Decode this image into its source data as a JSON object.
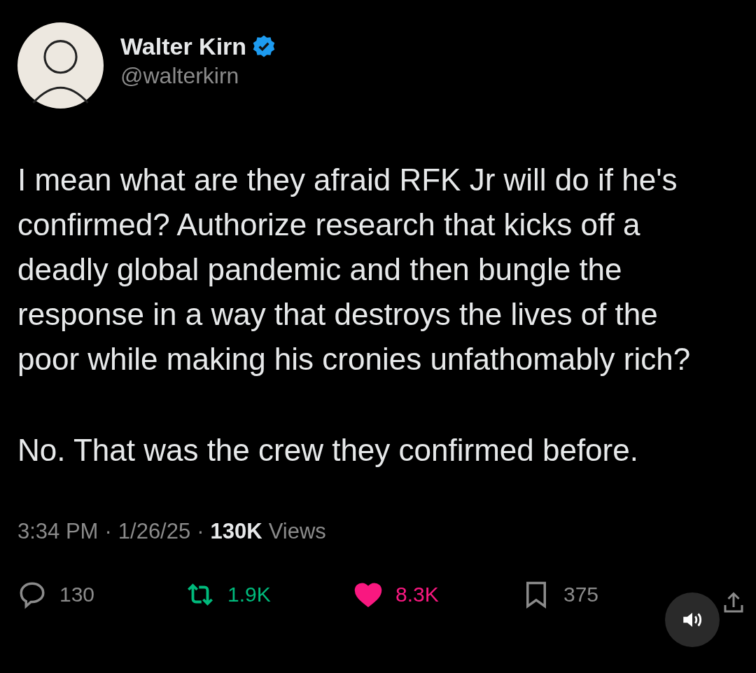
{
  "author": {
    "name": "Walter Kirn",
    "handle": "@walterkirn",
    "verified": true
  },
  "paragraphs": [
    "I mean what are they afraid RFK Jr will do if he's confirmed? Authorize research that kicks off a deadly global pandemic and then bungle the response in a way that destroys the lives of the poor while making his cronies unfathomably rich?",
    "No. That was the crew they confirmed before."
  ],
  "meta": {
    "time": "3:34 PM",
    "separator": "·",
    "date": "1/26/25",
    "views_count": "130K",
    "views_label": "Views"
  },
  "actions": [
    {
      "kind": "reply",
      "count": "130",
      "selected": false
    },
    {
      "kind": "repost",
      "count": "1.9K",
      "selected": true
    },
    {
      "kind": "like",
      "count": "8.3K",
      "selected": true
    },
    {
      "kind": "bookmark",
      "count": "375",
      "selected": false
    },
    {
      "kind": "share"
    }
  ]
}
